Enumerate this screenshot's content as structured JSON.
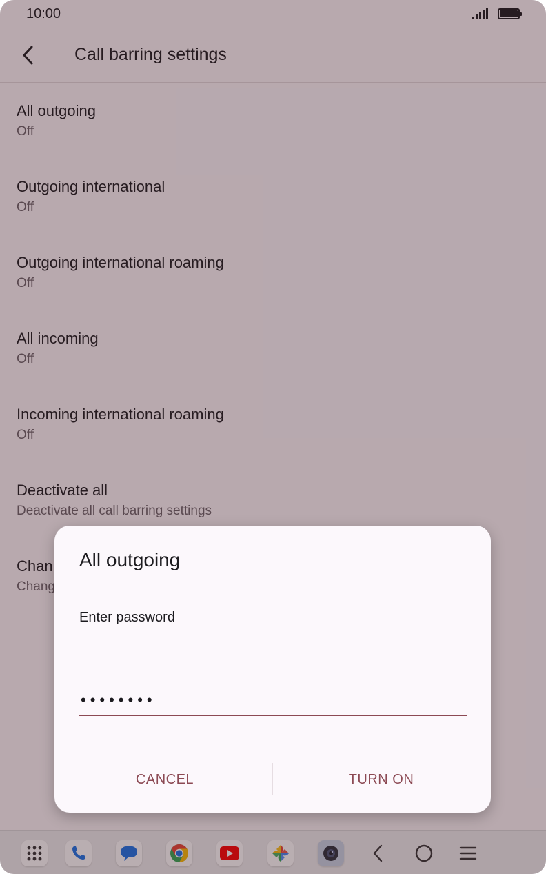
{
  "status_bar": {
    "time": "10:00"
  },
  "app_bar": {
    "title": "Call barring settings"
  },
  "settings": [
    {
      "title": "All outgoing",
      "subtitle": "Off"
    },
    {
      "title": "Outgoing international",
      "subtitle": "Off"
    },
    {
      "title": "Outgoing international roaming",
      "subtitle": "Off"
    },
    {
      "title": "All incoming",
      "subtitle": "Off"
    },
    {
      "title": "Incoming international roaming",
      "subtitle": "Off"
    },
    {
      "title": "Deactivate all",
      "subtitle": "Deactivate all call barring settings"
    },
    {
      "title": "Chan",
      "subtitle": "Chang"
    }
  ],
  "dialog": {
    "title": "All outgoing",
    "label": "Enter password",
    "password_value": "12345678",
    "cancel_label": "CANCEL",
    "confirm_label": "TURN ON"
  },
  "dock": {
    "apps": [
      "app-drawer-icon",
      "phone-icon",
      "messages-icon",
      "chrome-icon",
      "youtube-icon",
      "photos-icon",
      "camera-icon"
    ],
    "nav": [
      "back-icon",
      "home-icon",
      "recents-icon"
    ]
  },
  "colors": {
    "accent": "#8c4a54",
    "scrim": "#3c1e28",
    "dialog_bg": "#fcf8fc"
  }
}
